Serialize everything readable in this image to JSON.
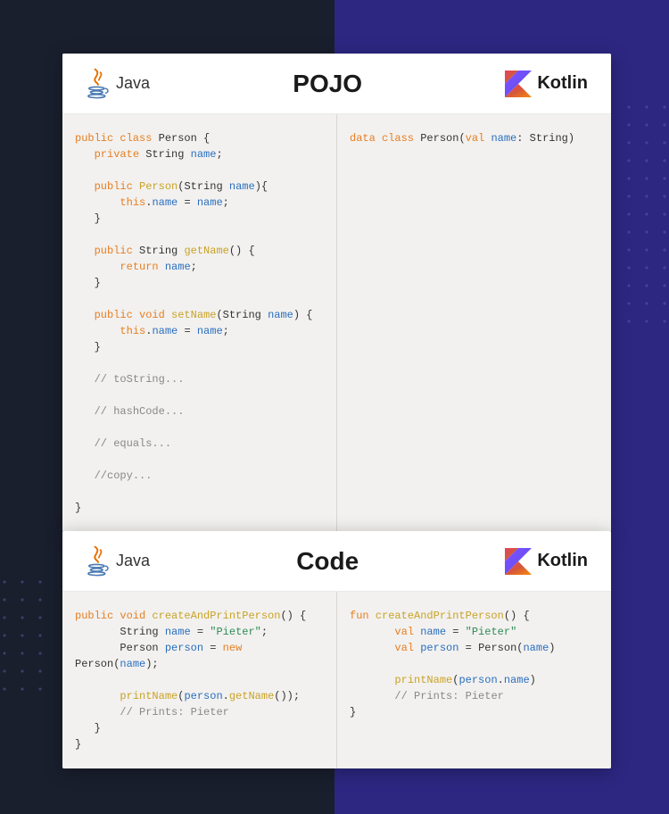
{
  "sections": [
    {
      "title": "POJO",
      "java_label": "Java",
      "kotlin_label": "Kotlin",
      "java_code_tokens": [
        [
          [
            "kw",
            "public class"
          ],
          [
            "type",
            " Person "
          ],
          [
            "pn",
            "{"
          ]
        ],
        [
          [
            "",
            "   "
          ],
          [
            "kw",
            "private"
          ],
          [
            "type",
            " String "
          ],
          [
            "var",
            "name"
          ],
          [
            "pn",
            ";"
          ]
        ],
        [
          [
            "",
            ""
          ]
        ],
        [
          [
            "",
            "   "
          ],
          [
            "kw",
            "public"
          ],
          [
            "fn",
            " Person"
          ],
          [
            "pn",
            "("
          ],
          [
            "type",
            "String "
          ],
          [
            "var",
            "name"
          ],
          [
            "pn",
            "){"
          ]
        ],
        [
          [
            "",
            "       "
          ],
          [
            "kw",
            "this"
          ],
          [
            "pn",
            "."
          ],
          [
            "var",
            "name"
          ],
          [
            "pn",
            " = "
          ],
          [
            "var",
            "name"
          ],
          [
            "pn",
            ";"
          ]
        ],
        [
          [
            "",
            "   "
          ],
          [
            "pn",
            "}"
          ]
        ],
        [
          [
            "",
            ""
          ]
        ],
        [
          [
            "",
            "   "
          ],
          [
            "kw",
            "public"
          ],
          [
            "type",
            " String "
          ],
          [
            "fn",
            "getName"
          ],
          [
            "pn",
            "() {"
          ]
        ],
        [
          [
            "",
            "       "
          ],
          [
            "kw",
            "return"
          ],
          [
            "var",
            " name"
          ],
          [
            "pn",
            ";"
          ]
        ],
        [
          [
            "",
            "   "
          ],
          [
            "pn",
            "}"
          ]
        ],
        [
          [
            "",
            ""
          ]
        ],
        [
          [
            "",
            "   "
          ],
          [
            "kw",
            "public void"
          ],
          [
            "fn",
            " setName"
          ],
          [
            "pn",
            "("
          ],
          [
            "type",
            "String "
          ],
          [
            "var",
            "name"
          ],
          [
            "pn",
            ") {"
          ]
        ],
        [
          [
            "",
            "       "
          ],
          [
            "kw",
            "this"
          ],
          [
            "pn",
            "."
          ],
          [
            "var",
            "name"
          ],
          [
            "pn",
            " = "
          ],
          [
            "var",
            "name"
          ],
          [
            "pn",
            ";"
          ]
        ],
        [
          [
            "",
            "   "
          ],
          [
            "pn",
            "}"
          ]
        ],
        [
          [
            "",
            ""
          ]
        ],
        [
          [
            "",
            "   "
          ],
          [
            "cm",
            "// toString..."
          ]
        ],
        [
          [
            "",
            ""
          ]
        ],
        [
          [
            "",
            "   "
          ],
          [
            "cm",
            "// hashCode..."
          ]
        ],
        [
          [
            "",
            ""
          ]
        ],
        [
          [
            "",
            "   "
          ],
          [
            "cm",
            "// equals..."
          ]
        ],
        [
          [
            "",
            ""
          ]
        ],
        [
          [
            "",
            "   "
          ],
          [
            "cm",
            "//copy..."
          ]
        ],
        [
          [
            "",
            ""
          ]
        ],
        [
          [
            "pn",
            "}"
          ]
        ]
      ],
      "kotlin_code_tokens": [
        [
          [
            "kw",
            "data class"
          ],
          [
            "type",
            " Person"
          ],
          [
            "pn",
            "("
          ],
          [
            "kw",
            "val"
          ],
          [
            "var",
            " name"
          ],
          [
            "pn",
            ": "
          ],
          [
            "type",
            "String"
          ],
          [
            "pn",
            ")"
          ]
        ]
      ]
    },
    {
      "title": "Code",
      "java_label": "Java",
      "kotlin_label": "Kotlin",
      "java_code_tokens": [
        [
          [
            "kw",
            "public void"
          ],
          [
            "fn",
            " createAndPrintPerson"
          ],
          [
            "pn",
            "() {"
          ]
        ],
        [
          [
            "",
            "       "
          ],
          [
            "type",
            "String "
          ],
          [
            "var",
            "name"
          ],
          [
            "pn",
            " = "
          ],
          [
            "str",
            "\"Pieter\""
          ],
          [
            "pn",
            ";"
          ]
        ],
        [
          [
            "",
            "       "
          ],
          [
            "type",
            "Person "
          ],
          [
            "var",
            "person"
          ],
          [
            "pn",
            " = "
          ],
          [
            "kw",
            "new"
          ]
        ],
        [
          [
            "type",
            "Person"
          ],
          [
            "pn",
            "("
          ],
          [
            "var",
            "name"
          ],
          [
            "pn",
            ");"
          ]
        ],
        [
          [
            "",
            ""
          ]
        ],
        [
          [
            "",
            "       "
          ],
          [
            "fn",
            "printName"
          ],
          [
            "pn",
            "("
          ],
          [
            "var",
            "person"
          ],
          [
            "pn",
            "."
          ],
          [
            "fn",
            "getName"
          ],
          [
            "pn",
            "());"
          ]
        ],
        [
          [
            "",
            "       "
          ],
          [
            "cm",
            "// Prints: Pieter"
          ]
        ],
        [
          [
            "",
            "   "
          ],
          [
            "pn",
            "}"
          ]
        ],
        [
          [
            "pn",
            "}"
          ]
        ]
      ],
      "kotlin_code_tokens": [
        [
          [
            "kw",
            "fun"
          ],
          [
            "fn",
            " createAndPrintPerson"
          ],
          [
            "pn",
            "() {"
          ]
        ],
        [
          [
            "",
            "       "
          ],
          [
            "kw",
            "val"
          ],
          [
            "var",
            " name"
          ],
          [
            "pn",
            " = "
          ],
          [
            "str",
            "\"Pieter\""
          ]
        ],
        [
          [
            "",
            "       "
          ],
          [
            "kw",
            "val"
          ],
          [
            "var",
            " person"
          ],
          [
            "pn",
            " = "
          ],
          [
            "type",
            "Person"
          ],
          [
            "pn",
            "("
          ],
          [
            "var",
            "name"
          ],
          [
            "pn",
            ")"
          ]
        ],
        [
          [
            "",
            ""
          ]
        ],
        [
          [
            "",
            "       "
          ],
          [
            "fn",
            "printName"
          ],
          [
            "pn",
            "("
          ],
          [
            "var",
            "person"
          ],
          [
            "pn",
            "."
          ],
          [
            "var",
            "name"
          ],
          [
            "pn",
            ")"
          ]
        ],
        [
          [
            "",
            "       "
          ],
          [
            "cm",
            "// Prints: Pieter"
          ]
        ],
        [
          [
            "pn",
            "}"
          ]
        ]
      ]
    }
  ]
}
